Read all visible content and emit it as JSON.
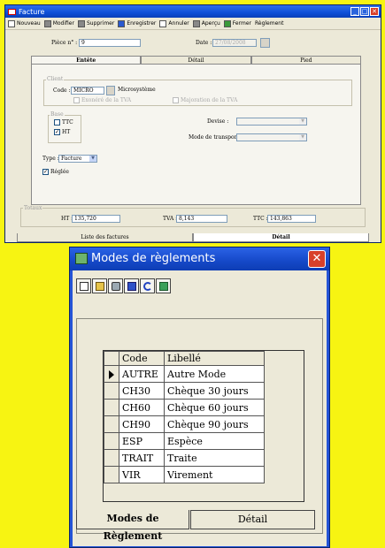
{
  "facture": {
    "title": "Facture",
    "toolbar": [
      "Nouveau",
      "Modifier",
      "Supprimer",
      "Enregistrer",
      "Annuler",
      "Aperçu",
      "Fermer",
      "Règlement"
    ],
    "piece_label": "Pièce n° :",
    "piece_value": "9",
    "date_label": "Date :",
    "date_value": "27/08/2008",
    "tabs": [
      "Entête",
      "Détail",
      "Pied"
    ],
    "client_group": "Client",
    "code_label": "Code :",
    "code_value": "MICRO",
    "client_name": "Microsystème",
    "exonere": "Exonéré de la TVA",
    "majoration": "Majoration de la TVA",
    "base_group": "Base",
    "ttc_check": "TTC",
    "ht_check": "HT",
    "devise_label": "Devise :",
    "transport_label": "Mode de transport :",
    "type_label": "Type :",
    "type_value": "Facture",
    "reglee": "Réglée",
    "totaux_group": "Totaux",
    "ht_label": "HT :",
    "ht_value": "135,720",
    "tva_label": "TVA :",
    "tva_value": "8,143",
    "ttc_label": "TTC :",
    "ttc_value": "143,863",
    "bottom_tabs": [
      "Liste des factures",
      "Détail"
    ]
  },
  "modes": {
    "title": "Modes de règlements",
    "close": "✕",
    "table": {
      "columns": [
        "Code",
        "Libellé"
      ],
      "rows": [
        {
          "code": "AUTRE",
          "libelle": "Autre Mode"
        },
        {
          "code": "CH30",
          "libelle": "Chèque 30 jours"
        },
        {
          "code": "CH60",
          "libelle": "Chèque 60 jours"
        },
        {
          "code": "CH90",
          "libelle": "Chèque 90 jours"
        },
        {
          "code": "ESP",
          "libelle": "Espèce"
        },
        {
          "code": "TRAIT",
          "libelle": "Traite"
        },
        {
          "code": "VIR",
          "libelle": "Virement"
        }
      ]
    },
    "tabs": [
      "Modes de Règlement",
      "Détail"
    ]
  }
}
